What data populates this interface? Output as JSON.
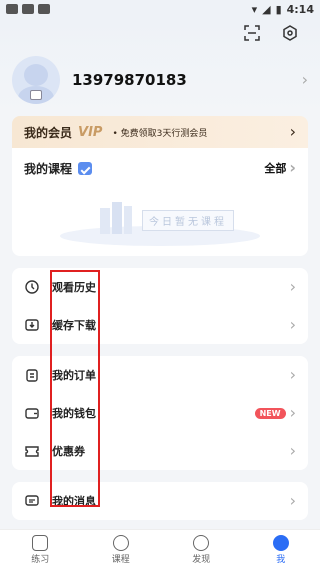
{
  "status_bar": {
    "time": "4:14"
  },
  "profile": {
    "phone": "13979870183"
  },
  "vip": {
    "title": "我的会员",
    "badge": "VIP",
    "desc": "• 免费领取3天行测会员"
  },
  "course": {
    "title": "我的课程",
    "all": "全部",
    "empty_text": "今日暂无课程"
  },
  "group1": [
    {
      "label": "观看历史",
      "icon": "clock-icon"
    },
    {
      "label": "缓存下载",
      "icon": "download-icon"
    }
  ],
  "group2": [
    {
      "label": "我的订单",
      "icon": "clipboard-icon"
    },
    {
      "label": "我的钱包",
      "icon": "wallet-icon",
      "badge": "NEW"
    },
    {
      "label": "优惠券",
      "icon": "coupon-icon"
    }
  ],
  "group3": [
    {
      "label": "我的消息",
      "icon": "message-icon"
    }
  ],
  "tabbar": [
    {
      "label": "练习",
      "icon": "book-icon"
    },
    {
      "label": "课程",
      "icon": "play-icon"
    },
    {
      "label": "发现",
      "icon": "compass-icon"
    },
    {
      "label": "我",
      "icon": "smile-icon",
      "active": true
    }
  ],
  "colors": {
    "accent": "#2b6df5",
    "new_badge": "#f2545b",
    "highlight": "#e02020"
  }
}
